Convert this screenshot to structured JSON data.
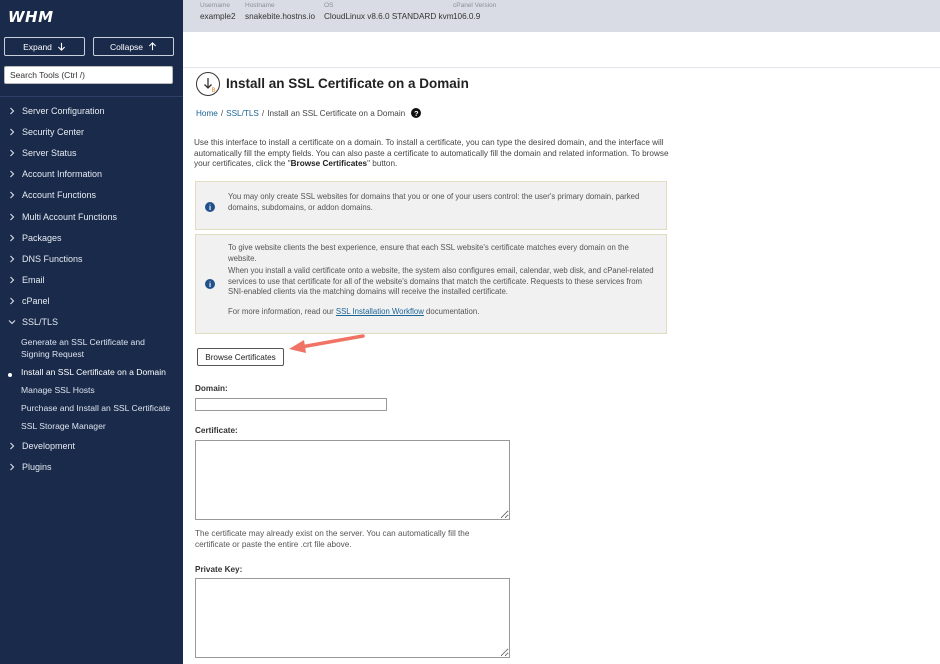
{
  "sidebar": {
    "logo": "WHM",
    "expand_label": "Expand",
    "collapse_label": "Collapse",
    "search_placeholder": "Search Tools (Ctrl /)",
    "items": [
      {
        "label": "Server Configuration"
      },
      {
        "label": "Security Center"
      },
      {
        "label": "Server Status"
      },
      {
        "label": "Account Information"
      },
      {
        "label": "Account Functions"
      },
      {
        "label": "Multi Account Functions"
      },
      {
        "label": "Packages"
      },
      {
        "label": "DNS Functions"
      },
      {
        "label": "Email"
      },
      {
        "label": "cPanel"
      },
      {
        "label": "SSL/TLS"
      },
      {
        "label": "Development"
      },
      {
        "label": "Plugins"
      }
    ],
    "ssl_sub": [
      {
        "label": "Generate an SSL Certificate and Signing Request"
      },
      {
        "label": "Install an SSL Certificate on a Domain"
      },
      {
        "label": "Manage SSL Hosts"
      },
      {
        "label": "Purchase and Install an SSL Certificate"
      },
      {
        "label": "SSL Storage Manager"
      }
    ]
  },
  "topbar": {
    "username_label": "Username",
    "username": "example2",
    "hostname_label": "Hostname",
    "hostname": "snakebite.hostns.io",
    "os_label": "OS",
    "os": "CloudLinux v8.6.0 STANDARD kvm",
    "version_label": "cPanel Version",
    "version": "106.0.9"
  },
  "page": {
    "title": "Install an SSL Certificate on a Domain",
    "breadcrumb": {
      "home": "Home",
      "sep": "/",
      "section": "SSL/TLS",
      "current": "Install an SSL Certificate on a Domain"
    },
    "help_glyph": "?",
    "intro_text": "Use this interface to install a certificate on a domain. To install a certificate, you can type the desired domain, and the interface will automatically fill the empty fields. You can also paste a certificate to automatically fill the domain and related information. To browse your certificates, click the \"",
    "intro_bold": "Browse Certificates",
    "intro_end": "\" button.",
    "alert1": "You may only create SSL websites for domains that you or one of your users control: the user's primary domain, parked domains, subdomains, or addon domains.",
    "alert2_p1": "To give website clients the best experience, ensure that each SSL website's certificate matches every domain on the website.",
    "alert2_p2": "When you install a valid certificate onto a website, the system also configures email, calendar, web disk, and cPanel-related services to use that certificate for all of the website's domains that match the certificate. Requests to these services from SNI-enabled clients via the matching domains will receive the installed certificate.",
    "alert2_p3_pre": "For more information, read our ",
    "alert2_link": "SSL Installation Workflow",
    "alert2_p3_post": " documentation.",
    "info_glyph": "i",
    "browse_button": "Browse Certificates",
    "domain_label": "Domain:",
    "domain_value": "",
    "certificate_label": "Certificate:",
    "certificate_help": "The certificate may already exist on the server. You can automatically fill the certificate or paste the entire .crt file above.",
    "private_key_label": "Private Key:"
  },
  "colors": {
    "sidebar_bg": "#1a2a4a",
    "topbar_bg": "#d9dce4",
    "alert_icon": "#22508b",
    "arrow": "#f07366",
    "link": "#1a6496"
  }
}
